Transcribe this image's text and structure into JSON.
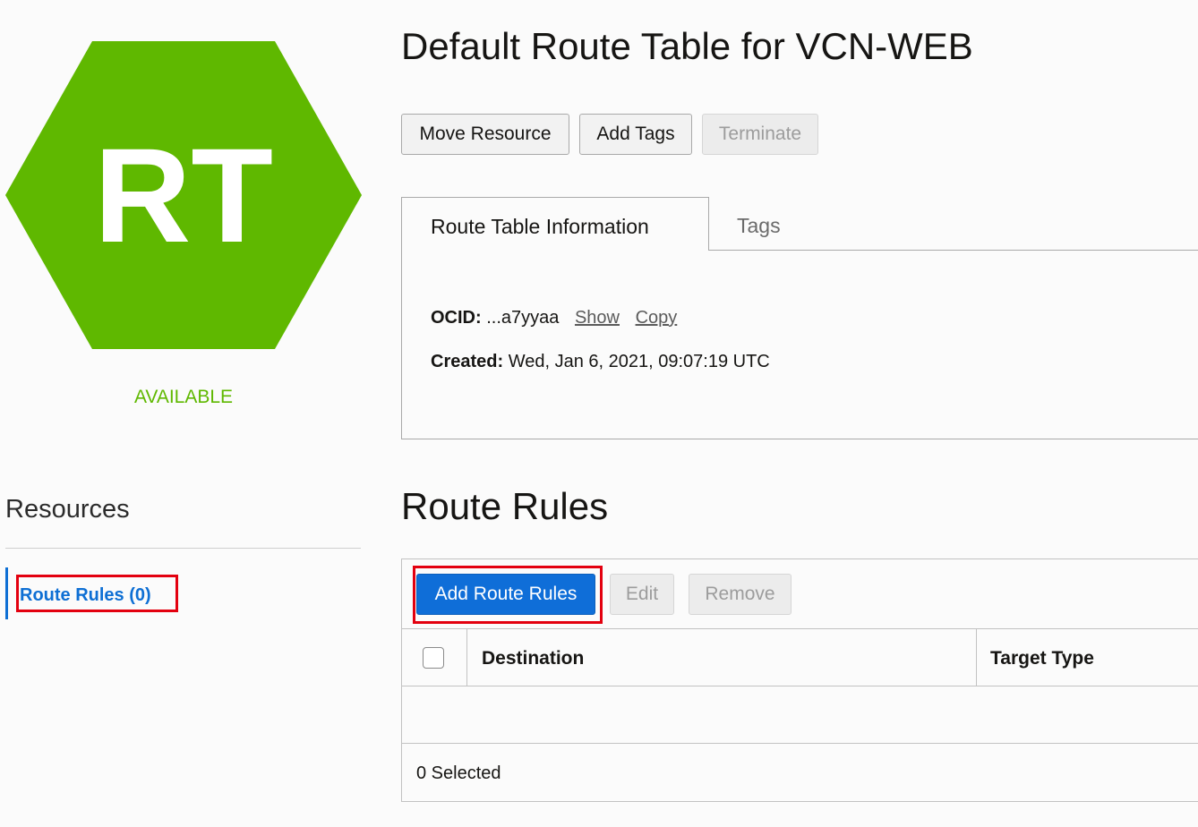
{
  "resource_icon": {
    "text": "RT",
    "color": "#5fb800"
  },
  "status": "AVAILABLE",
  "resources": {
    "title": "Resources",
    "items": [
      {
        "label": "Route Rules (0)"
      }
    ]
  },
  "page_title": "Default Route Table for VCN-WEB",
  "actions": {
    "move_resource": "Move Resource",
    "add_tags": "Add Tags",
    "terminate": "Terminate"
  },
  "tabs": [
    {
      "label": "Route Table Information",
      "active": true
    },
    {
      "label": "Tags",
      "active": false
    }
  ],
  "info": {
    "ocid_label": "OCID:",
    "ocid_value": "...a7yyaa",
    "show_link": "Show",
    "copy_link": "Copy",
    "created_label": "Created:",
    "created_value": "Wed, Jan 6, 2021, 09:07:19 UTC"
  },
  "route_rules": {
    "title": "Route Rules",
    "add_button": "Add Route Rules",
    "edit_button": "Edit",
    "remove_button": "Remove",
    "columns": [
      "Destination",
      "Target Type"
    ],
    "rows": [],
    "selected_text": "0 Selected"
  },
  "colors": {
    "accent": "#0f6ed8",
    "status_green": "#5fb800",
    "highlight_red": "#e3000f"
  }
}
